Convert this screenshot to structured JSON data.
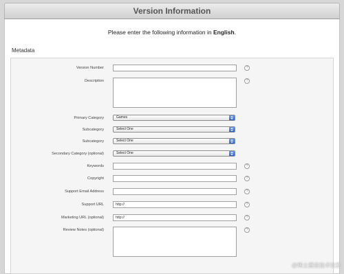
{
  "window": {
    "title": "Version Information"
  },
  "intro": {
    "prefix": "Please enter the following information in ",
    "language": "English",
    "suffix": "."
  },
  "section": {
    "title": "Metadata"
  },
  "fields": {
    "version_number": {
      "label": "Version Number",
      "value": ""
    },
    "description": {
      "label": "Description",
      "value": ""
    },
    "primary_category": {
      "label": "Primary Category",
      "selected": "Games"
    },
    "subcategory_1": {
      "label": "Subcategory",
      "selected": "Select One"
    },
    "subcategory_2": {
      "label": "Subcategory",
      "selected": "Select One"
    },
    "secondary_category": {
      "label": "Secondary Category (optional)",
      "selected": "Select One"
    },
    "keywords": {
      "label": "Keywords",
      "value": ""
    },
    "copyright": {
      "label": "Copyright",
      "value": ""
    },
    "support_email": {
      "label": "Support Email Address",
      "value": ""
    },
    "support_url": {
      "label": "Support URL",
      "value": "http://"
    },
    "marketing_url": {
      "label": "Marketing URL (optional)",
      "value": "http://"
    },
    "review_notes": {
      "label": "Review Notes (optional)",
      "value": ""
    }
  },
  "help_icon": "?",
  "watermark": "@稀土掘金技术社区"
}
